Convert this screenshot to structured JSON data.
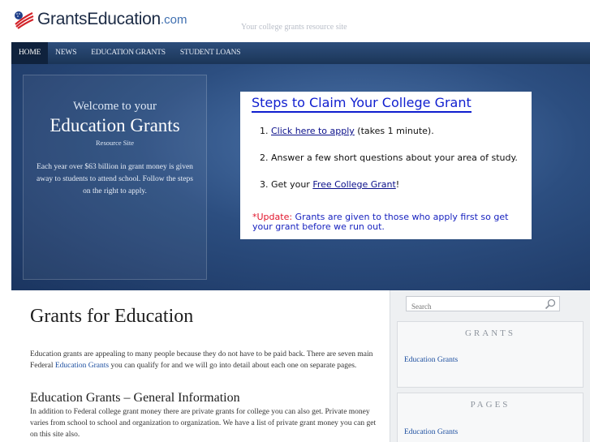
{
  "header": {
    "logo_main": "GrantsEducation",
    "logo_suffix": ".com",
    "tagline": "Your college grants resource site"
  },
  "nav": {
    "items": [
      {
        "label": "HOME"
      },
      {
        "label": "NEWS"
      },
      {
        "label": "EDUCATION GRANTS"
      },
      {
        "label": "STUDENT LOANS"
      }
    ]
  },
  "hero": {
    "welcome": "Welcome to your",
    "heading": "Education Grants",
    "sub": "Resource Site",
    "description": "Each year over $63 billion in grant money is given away to students to attend school. Follow the steps on the right to apply."
  },
  "steps": {
    "title": "Steps to Claim Your College Grant",
    "step1_prefix": "1. ",
    "step1_link": "Click here to apply",
    "step1_suffix": " (takes 1 minute).",
    "step2": "2. Answer a few short questions about your area of study.",
    "step3_prefix": "3. Get your ",
    "step3_link": "Free College Grant",
    "step3_suffix": "!",
    "update_label": "*Update:",
    "update_text": "Grants are given to those who apply first so get your grant before we run out."
  },
  "main": {
    "title": "Grants for Education",
    "intro_pre": "Education grants are appealing to many people because they do not have to be paid back.  There are seven main Federal ",
    "intro_link": "Education Grants",
    "intro_post": " you can qualify for and we will go into detail about each one on separate pages.",
    "section_title": "Education Grants – General Information",
    "section_text": "In addition to Federal college grant money there are private grants for college you can also get. Private money varies from school to school and organization to organization. We have a list of private grant money you can get on this site also."
  },
  "sidebar": {
    "search_placeholder": "Search",
    "widgets": [
      {
        "title": "GRANTS",
        "link": "Education Grants"
      },
      {
        "title": "PAGES",
        "link": "Education Grants"
      }
    ]
  },
  "colors": {
    "nav_bg": "#1b3557",
    "hero_bg": "#2c4e80",
    "link": "#1d4fa0",
    "steps_title": "#0f1ecf",
    "update_label": "#e1142b"
  }
}
